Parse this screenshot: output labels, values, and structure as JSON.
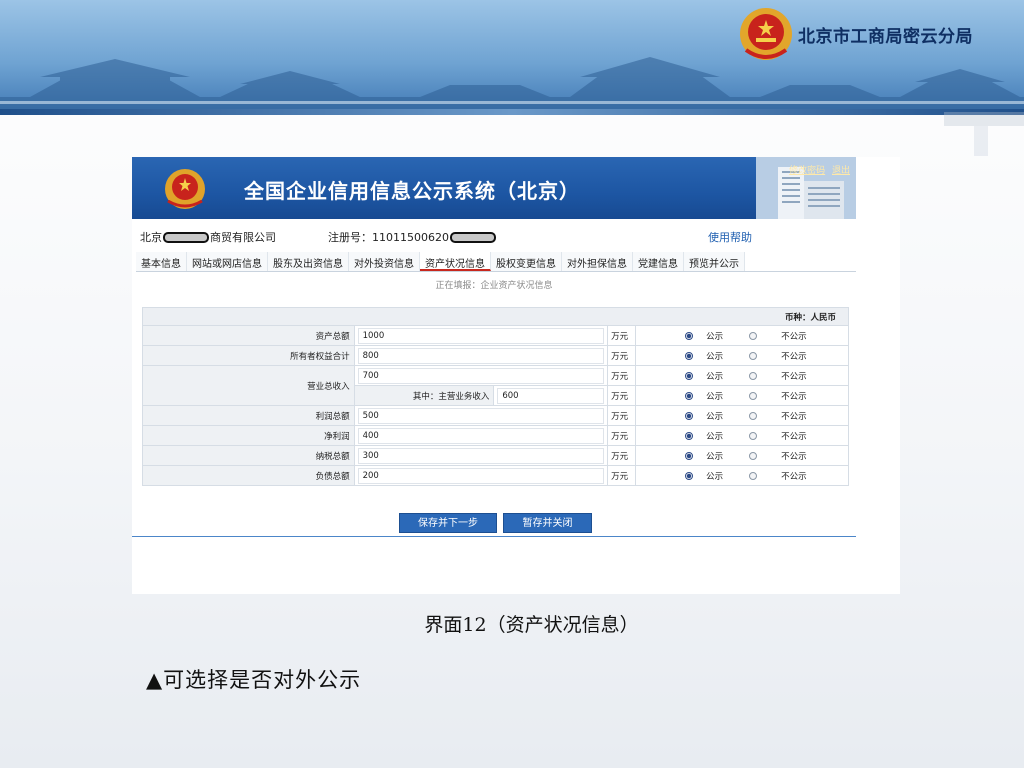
{
  "banner": {
    "org_name": "北京市工商局密云分局"
  },
  "app": {
    "title": "全国企业信用信息公示系统（北京）",
    "links": [
      "修改密码",
      "退出"
    ],
    "company_prefix": "北京",
    "company_suffix": "商贸有限公司",
    "reg_label": "注册号：11011500620",
    "help": "使用帮助",
    "tabs": [
      {
        "label": "基本信息",
        "active": false
      },
      {
        "label": "网站或网店信息",
        "active": false
      },
      {
        "label": "股东及出资信息",
        "active": false
      },
      {
        "label": "对外投资信息",
        "active": false
      },
      {
        "label": "资产状况信息",
        "active": true
      },
      {
        "label": "股权变更信息",
        "active": false
      },
      {
        "label": "对外担保信息",
        "active": false
      },
      {
        "label": "党建信息",
        "active": false
      },
      {
        "label": "预览并公示",
        "active": false
      }
    ],
    "filling_status": "正在填报：企业资产状况信息",
    "currency": "币种：人民币",
    "unit": "万元",
    "public_label": "公示",
    "private_label": "不公示",
    "rows": {
      "total_assets": {
        "label": "资产总额",
        "value": "1000"
      },
      "owner_equity": {
        "label": "所有者权益合计",
        "value": "800"
      },
      "revenue": {
        "label": "营业总收入",
        "value": "700"
      },
      "main_revenue": {
        "label": "其中：主营业务收入",
        "value": "600"
      },
      "total_profit": {
        "label": "利润总额",
        "value": "500"
      },
      "net_profit": {
        "label": "净利润",
        "value": "400"
      },
      "tax_total": {
        "label": "纳税总额",
        "value": "300"
      },
      "total_liabilities": {
        "label": "负债总额",
        "value": "200"
      }
    },
    "buttons": {
      "save_next": "保存并下一步",
      "save_close": "暂存并关闭"
    }
  },
  "caption": "界面12（资产状况信息）",
  "note": "▲可选择是否对外公示"
}
